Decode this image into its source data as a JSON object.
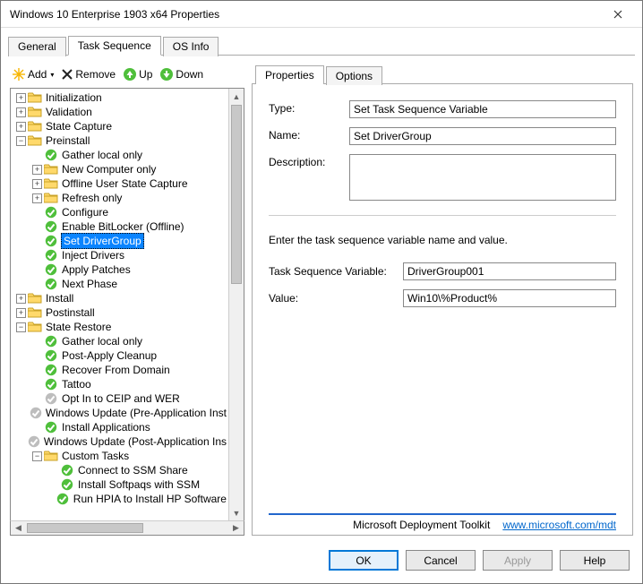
{
  "window": {
    "title": "Windows 10 Enterprise 1903 x64 Properties"
  },
  "mainTabs": {
    "items": [
      "General",
      "Task Sequence",
      "OS Info"
    ],
    "activeIndex": 1
  },
  "toolbar": {
    "add": "Add",
    "remove": "Remove",
    "up": "Up",
    "down": "Down"
  },
  "tree": [
    {
      "depth": 0,
      "tw": "+",
      "icon": "folder",
      "label": "Initialization"
    },
    {
      "depth": 0,
      "tw": "+",
      "icon": "folder",
      "label": "Validation"
    },
    {
      "depth": 0,
      "tw": "+",
      "icon": "folder",
      "label": "State Capture"
    },
    {
      "depth": 0,
      "tw": "-",
      "icon": "folder",
      "label": "Preinstall"
    },
    {
      "depth": 1,
      "tw": "",
      "icon": "check",
      "label": "Gather local only"
    },
    {
      "depth": 1,
      "tw": "+",
      "icon": "folder",
      "label": "New Computer only"
    },
    {
      "depth": 1,
      "tw": "+",
      "icon": "folder",
      "label": "Offline User State Capture"
    },
    {
      "depth": 1,
      "tw": "+",
      "icon": "folder",
      "label": "Refresh only"
    },
    {
      "depth": 1,
      "tw": "",
      "icon": "check",
      "label": "Configure"
    },
    {
      "depth": 1,
      "tw": "",
      "icon": "check",
      "label": "Enable BitLocker (Offline)"
    },
    {
      "depth": 1,
      "tw": "",
      "icon": "check",
      "label": "Set DriverGroup",
      "selected": true
    },
    {
      "depth": 1,
      "tw": "",
      "icon": "check",
      "label": "Inject Drivers"
    },
    {
      "depth": 1,
      "tw": "",
      "icon": "check",
      "label": "Apply Patches"
    },
    {
      "depth": 1,
      "tw": "",
      "icon": "check",
      "label": "Next Phase"
    },
    {
      "depth": 0,
      "tw": "+",
      "icon": "folder",
      "label": "Install"
    },
    {
      "depth": 0,
      "tw": "+",
      "icon": "folder",
      "label": "Postinstall"
    },
    {
      "depth": 0,
      "tw": "-",
      "icon": "folder",
      "label": "State Restore"
    },
    {
      "depth": 1,
      "tw": "",
      "icon": "check",
      "label": "Gather local only"
    },
    {
      "depth": 1,
      "tw": "",
      "icon": "check",
      "label": "Post-Apply Cleanup"
    },
    {
      "depth": 1,
      "tw": "",
      "icon": "check",
      "label": "Recover From Domain"
    },
    {
      "depth": 1,
      "tw": "",
      "icon": "check",
      "label": "Tattoo"
    },
    {
      "depth": 1,
      "tw": "",
      "icon": "disabled",
      "label": "Opt In to CEIP and WER"
    },
    {
      "depth": 1,
      "tw": "",
      "icon": "disabled",
      "label": "Windows Update (Pre-Application Inst"
    },
    {
      "depth": 1,
      "tw": "",
      "icon": "check",
      "label": "Install Applications"
    },
    {
      "depth": 1,
      "tw": "",
      "icon": "disabled",
      "label": "Windows Update (Post-Application Ins"
    },
    {
      "depth": 1,
      "tw": "-",
      "icon": "folder",
      "label": "Custom Tasks"
    },
    {
      "depth": 2,
      "tw": "",
      "icon": "check",
      "label": "Connect to SSM Share"
    },
    {
      "depth": 2,
      "tw": "",
      "icon": "check",
      "label": "Install Softpaqs with SSM"
    },
    {
      "depth": 2,
      "tw": "",
      "icon": "check",
      "label": "Run HPIA to Install HP Software"
    }
  ],
  "propTabs": {
    "items": [
      "Properties",
      "Options"
    ],
    "activeIndex": 0
  },
  "props": {
    "typeLabel": "Type:",
    "typeValue": "Set Task Sequence Variable",
    "nameLabel": "Name:",
    "nameValue": "Set DriverGroup",
    "descLabel": "Description:",
    "descValue": "",
    "instruction": "Enter the task sequence variable name and value.",
    "varLabel": "Task Sequence Variable:",
    "varValue": "DriverGroup001",
    "valueLabel": "Value:",
    "valueValue": "Win10\\%Product%"
  },
  "footer": {
    "product": "Microsoft Deployment Toolkit",
    "linkText": "www.microsoft.com/mdt"
  },
  "buttons": {
    "ok": "OK",
    "cancel": "Cancel",
    "apply": "Apply",
    "help": "Help"
  }
}
